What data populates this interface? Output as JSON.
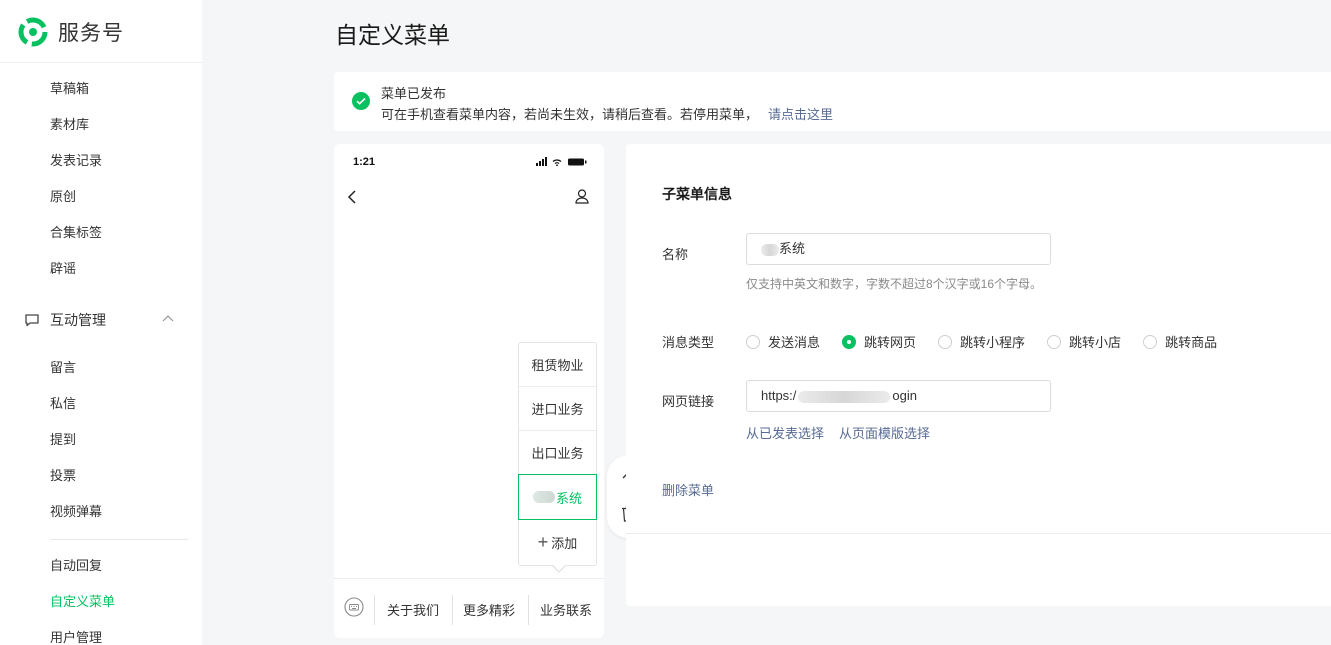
{
  "app": {
    "name": "服务号"
  },
  "sidebar": {
    "items_top": [
      {
        "label": "草稿箱"
      },
      {
        "label": "素材库"
      },
      {
        "label": "发表记录"
      },
      {
        "label": "原创"
      },
      {
        "label": "合集标签"
      },
      {
        "label": "辟谣"
      }
    ],
    "group": {
      "label": "互动管理",
      "icon": "message-icon",
      "expanded": true
    },
    "group_items": [
      {
        "label": "留言"
      },
      {
        "label": "私信"
      },
      {
        "label": "提到"
      },
      {
        "label": "投票"
      },
      {
        "label": "视频弹幕"
      }
    ],
    "items_bottom": [
      {
        "label": "自动回复"
      },
      {
        "label": "自定义菜单",
        "active": true
      },
      {
        "label": "用户管理"
      }
    ]
  },
  "page": {
    "title": "自定义菜单"
  },
  "notice": {
    "title": "菜单已发布",
    "desc": "可在手机查看菜单内容，若尚未生效，请稍后查看。若停用菜单，",
    "link": "请点击这里"
  },
  "phone": {
    "time": "1:21",
    "submenu": [
      {
        "label": "租赁物业"
      },
      {
        "label": "进口业务"
      },
      {
        "label": "出口业务"
      },
      {
        "label": "系统",
        "selected": true
      }
    ],
    "add_label": "添加",
    "tabs": [
      {
        "label": "关于我们"
      },
      {
        "label": "更多精彩"
      },
      {
        "label": "业务联系"
      }
    ]
  },
  "editor": {
    "title": "子菜单信息",
    "name_label": "名称",
    "name_value": "系统",
    "name_hint": "仅支持中英文和数字，字数不超过8个汉字或16个字母。",
    "type_label": "消息类型",
    "types": [
      {
        "label": "发送消息",
        "checked": false
      },
      {
        "label": "跳转网页",
        "checked": true
      },
      {
        "label": "跳转小程序",
        "checked": false
      },
      {
        "label": "跳转小店",
        "checked": false
      },
      {
        "label": "跳转商品",
        "checked": false
      }
    ],
    "url_label": "网页链接",
    "url_prefix": "https:/",
    "url_suffix": "ogin",
    "link_published": "从已发表选择",
    "link_template": "从页面模版选择",
    "delete_label": "删除菜单"
  },
  "colors": {
    "accent": "#07c160",
    "link": "#576b95",
    "background": "#f5f6f7"
  }
}
